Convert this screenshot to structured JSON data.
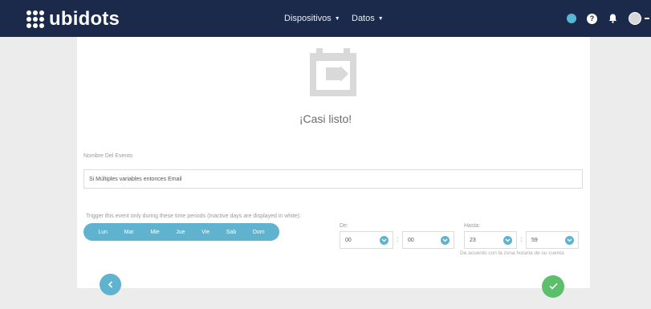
{
  "header": {
    "logo_text": "ubidots",
    "menu_devices": "Dispositivos",
    "menu_data": "Datos",
    "help_glyph": "?"
  },
  "wizard": {
    "title": "¡Casi listo!",
    "event_name_label": "Nombre Del Evento",
    "event_name_value": "Si Múltiples variables entonces Email",
    "trigger_label": "Trigger this event only during these time periods (Inactive days are displayed in white):",
    "days": [
      "Lun",
      "Mar",
      "Mie",
      "Jue",
      "Vie",
      "Sab",
      "Dom"
    ],
    "from_label": "De:",
    "from_hour": "00",
    "from_minute": "00",
    "to_label": "Hasta:",
    "to_hour": "23",
    "to_minute": "59",
    "time_separator": ":",
    "timezone_note": "De acuerdo con la zona horaria de su cuenta"
  },
  "colors": {
    "navbar": "#1b2a4b",
    "accent": "#5fb3cf",
    "confirm": "#5cbf6a"
  },
  "icons": {
    "hero": "event-export-icon",
    "back": "chevron-left-icon",
    "confirm": "check-icon"
  }
}
